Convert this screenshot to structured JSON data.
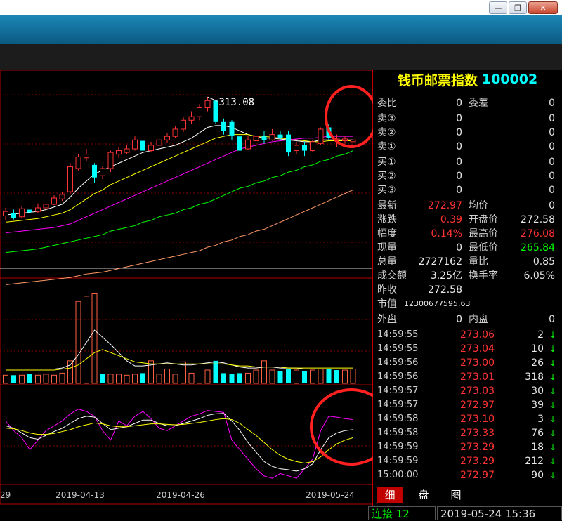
{
  "window": {
    "min_glyph": "—",
    "max_glyph": "❐",
    "close_glyph": "✕"
  },
  "chart_data": [
    {
      "type": "candlestick",
      "title": "",
      "annotations": [
        {
          "label": "313.08",
          "point": "high"
        }
      ],
      "series_colors": {
        "ma1": "#ffffff",
        "ma2": "#ffff00",
        "ma3": "#ff00ff",
        "ma4": "#00ff00",
        "ma5": "#ff9966"
      },
      "ylim": [
        220,
        330
      ],
      "candles": [
        {
          "o": 248.5,
          "c": 251.0,
          "h": 253.0,
          "l": 246.0
        },
        {
          "o": 250.0,
          "c": 247.5,
          "h": 252.0,
          "l": 246.5
        },
        {
          "o": 248.0,
          "c": 252.5,
          "h": 254.0,
          "l": 247.0
        },
        {
          "o": 252.0,
          "c": 250.5,
          "h": 254.5,
          "l": 249.0
        },
        {
          "o": 251.0,
          "c": 253.0,
          "h": 255.5,
          "l": 250.0
        },
        {
          "o": 253.0,
          "c": 255.0,
          "h": 257.0,
          "l": 252.0
        },
        {
          "o": 255.0,
          "c": 258.5,
          "h": 260.0,
          "l": 254.5
        },
        {
          "o": 258.0,
          "c": 260.5,
          "h": 262.0,
          "l": 257.0
        },
        {
          "o": 262.0,
          "c": 276.0,
          "h": 278.0,
          "l": 261.0
        },
        {
          "o": 275.0,
          "c": 281.5,
          "h": 283.0,
          "l": 274.0
        },
        {
          "o": 281.0,
          "c": 283.0,
          "h": 286.0,
          "l": 279.0
        },
        {
          "o": 277.0,
          "c": 270.0,
          "h": 278.0,
          "l": 267.0
        },
        {
          "o": 271.0,
          "c": 275.0,
          "h": 276.5,
          "l": 269.0
        },
        {
          "o": 275.0,
          "c": 284.0,
          "h": 285.0,
          "l": 273.0
        },
        {
          "o": 283.0,
          "c": 285.0,
          "h": 287.0,
          "l": 281.0
        },
        {
          "o": 284.0,
          "c": 286.0,
          "h": 288.0,
          "l": 283.0
        },
        {
          "o": 286.0,
          "c": 291.0,
          "h": 293.0,
          "l": 285.0
        },
        {
          "o": 290.5,
          "c": 285.0,
          "h": 292.0,
          "l": 283.0
        },
        {
          "o": 285.0,
          "c": 288.0,
          "h": 290.0,
          "l": 284.0
        },
        {
          "o": 288.0,
          "c": 291.0,
          "h": 292.5,
          "l": 286.0
        },
        {
          "o": 291.0,
          "c": 293.0,
          "h": 295.0,
          "l": 289.5
        },
        {
          "o": 293.0,
          "c": 297.0,
          "h": 298.5,
          "l": 292.0
        },
        {
          "o": 297.0,
          "c": 302.0,
          "h": 304.0,
          "l": 295.5
        },
        {
          "o": 302.0,
          "c": 304.0,
          "h": 307.0,
          "l": 300.0
        },
        {
          "o": 304.0,
          "c": 309.0,
          "h": 311.0,
          "l": 302.0
        },
        {
          "o": 309.0,
          "c": 313.0,
          "h": 315.0,
          "l": 307.0
        },
        {
          "o": 313.0,
          "c": 301.0,
          "h": 313.08,
          "l": 300.0
        },
        {
          "o": 301.0,
          "c": 296.0,
          "h": 303.0,
          "l": 294.0
        },
        {
          "o": 301.0,
          "c": 293.5,
          "h": 302.0,
          "l": 291.0
        },
        {
          "o": 293.0,
          "c": 285.0,
          "h": 296.0,
          "l": 284.0
        },
        {
          "o": 286.0,
          "c": 291.0,
          "h": 293.0,
          "l": 285.5
        },
        {
          "o": 290.5,
          "c": 293.0,
          "h": 295.0,
          "l": 289.0
        },
        {
          "o": 293.0,
          "c": 291.0,
          "h": 296.0,
          "l": 289.0
        },
        {
          "o": 291.0,
          "c": 294.0,
          "h": 297.0,
          "l": 290.5
        },
        {
          "o": 294.0,
          "c": 292.0,
          "h": 296.0,
          "l": 290.5
        },
        {
          "o": 294.0,
          "c": 284.0,
          "h": 296.0,
          "l": 282.0
        },
        {
          "o": 285.0,
          "c": 288.0,
          "h": 290.0,
          "l": 283.0
        },
        {
          "o": 288.0,
          "c": 285.0,
          "h": 290.0,
          "l": 282.0
        },
        {
          "o": 285.0,
          "c": 290.0,
          "h": 291.0,
          "l": 284.0
        },
        {
          "o": 289.0,
          "c": 297.0,
          "h": 298.0,
          "l": 288.0
        },
        {
          "o": 298.0,
          "c": 292.0,
          "h": 300.0,
          "l": 291.0
        },
        {
          "o": 291.0,
          "c": 291.5,
          "h": 294.0,
          "l": 287.0
        },
        {
          "o": 290.5,
          "c": 291.5,
          "h": 293.0,
          "l": 289.0
        },
        {
          "o": 290.0,
          "c": 291.0,
          "h": 292.0,
          "l": 288.5
        }
      ],
      "ma": {
        "ma1": [
          249,
          249.5,
          250,
          250.5,
          251,
          252,
          253.5,
          255,
          259,
          264,
          268,
          272,
          274,
          276,
          278,
          280,
          282,
          284,
          285,
          286,
          287,
          288,
          290,
          292,
          295,
          298,
          299,
          299,
          298,
          296,
          294,
          293,
          292,
          292,
          291.5,
          291,
          290.5,
          290,
          290,
          291,
          291,
          291,
          291,
          291
        ],
        "ma2": [
          245,
          245.5,
          246,
          246.5,
          247,
          248,
          249,
          250,
          252,
          255,
          258,
          261,
          263,
          266,
          268,
          270,
          272,
          274,
          276,
          278,
          280,
          282,
          284,
          286,
          288,
          290,
          292,
          293,
          294,
          294,
          294,
          293,
          293,
          292.5,
          292,
          291.5,
          291,
          290.5,
          290,
          290,
          290.5,
          290.5,
          290.5,
          290.5
        ],
        "ma3": [
          239,
          239.5,
          240,
          240.5,
          241,
          241.5,
          242,
          243,
          244,
          246,
          248,
          250,
          252,
          254,
          256,
          258,
          260,
          262,
          264,
          266,
          268,
          270,
          272,
          274,
          276,
          278,
          280,
          282,
          284,
          286,
          287,
          288,
          289,
          290,
          290.5,
          291,
          291.5,
          292,
          292,
          292.5,
          293,
          293,
          293,
          293
        ],
        "ma4": [
          228,
          228.5,
          229,
          229.5,
          230,
          231,
          232,
          233,
          234,
          235,
          236,
          237,
          238,
          240,
          241,
          242,
          243,
          245,
          246,
          248,
          249,
          250,
          252,
          253,
          255,
          256,
          258,
          260,
          262,
          264,
          265,
          267,
          268,
          270,
          271,
          273,
          274,
          276,
          277,
          279,
          280,
          282,
          283,
          285
        ],
        "ma5": [
          210,
          210.5,
          211,
          211.5,
          212,
          212.5,
          213,
          213.5,
          214,
          215,
          216,
          216.5,
          217,
          218,
          219,
          220,
          221,
          222,
          223,
          224,
          225,
          226,
          227,
          228,
          229,
          231,
          232,
          234,
          235,
          237,
          238,
          240,
          241,
          243,
          245,
          247,
          249,
          251,
          253,
          255,
          257,
          259,
          261,
          263
        ]
      }
    },
    {
      "type": "bar",
      "title": "",
      "ylim": [
        0,
        100
      ],
      "values": [
        8,
        8,
        8,
        9,
        8,
        9,
        8,
        10,
        22,
        80,
        85,
        88,
        9,
        9,
        9,
        8,
        9,
        10,
        22,
        9,
        14,
        9,
        21,
        10,
        12,
        13,
        22,
        10,
        9,
        10,
        10,
        13,
        22,
        13,
        12,
        14,
        13,
        12,
        13,
        14,
        14,
        13,
        13,
        14
      ],
      "up": [
        1,
        0,
        1,
        0,
        1,
        1,
        1,
        1,
        1,
        1,
        1,
        1,
        0,
        1,
        1,
        1,
        1,
        0,
        1,
        1,
        1,
        1,
        1,
        1,
        1,
        1,
        0,
        0,
        0,
        0,
        1,
        1,
        1,
        1,
        0,
        0,
        1,
        0,
        1,
        1,
        0,
        0,
        1,
        1
      ],
      "ma1": [
        14,
        14,
        14,
        14,
        14,
        14,
        14,
        15,
        18,
        28,
        40,
        52,
        45,
        38,
        30,
        22,
        17,
        17,
        18,
        19,
        20,
        19,
        18,
        18,
        19,
        20,
        21,
        20,
        18,
        16,
        15,
        15,
        16,
        16,
        15,
        15,
        15,
        14,
        14,
        14,
        14,
        14,
        14,
        14
      ],
      "ma2": [
        13,
        13,
        13,
        13,
        13,
        13,
        13,
        14,
        15,
        18,
        24,
        30,
        33,
        30,
        27,
        24,
        21,
        20,
        19,
        19,
        19,
        19,
        19,
        19,
        19,
        19,
        19,
        19,
        18,
        17,
        17,
        16,
        16,
        16,
        16,
        15,
        15,
        15,
        15,
        15,
        15,
        15,
        15,
        15
      ]
    },
    {
      "type": "line",
      "title": "",
      "ylim": [
        -100,
        100
      ],
      "x_ticks": [
        "29",
        "2019-04-13",
        "2019-04-26",
        "2019-05-24"
      ],
      "series": [
        {
          "color": "#ff00ff",
          "values": [
            30,
            10,
            -5,
            -30,
            -10,
            10,
            20,
            30,
            45,
            55,
            50,
            40,
            10,
            -10,
            30,
            20,
            40,
            50,
            35,
            15,
            10,
            20,
            30,
            40,
            45,
            52,
            50,
            48,
            -10,
            -30,
            -50,
            -70,
            -85,
            -90,
            -80,
            -85,
            -90,
            -70,
            -50,
            10,
            40,
            38,
            35,
            33
          ]
        },
        {
          "color": "#ffffff",
          "values": [
            20,
            15,
            5,
            -5,
            -8,
            0,
            8,
            15,
            25,
            35,
            40,
            38,
            25,
            12,
            15,
            18,
            25,
            32,
            32,
            25,
            20,
            20,
            25,
            30,
            35,
            42,
            45,
            46,
            30,
            10,
            -15,
            -35,
            -55,
            -65,
            -70,
            -72,
            -75,
            -70,
            -60,
            -30,
            -5,
            5,
            10,
            12
          ]
        },
        {
          "color": "#ffff00",
          "values": [
            15,
            14,
            10,
            5,
            2,
            2,
            4,
            8,
            12,
            18,
            22,
            26,
            24,
            20,
            18,
            18,
            20,
            22,
            24,
            24,
            23,
            22,
            23,
            25,
            27,
            30,
            33,
            35,
            33,
            25,
            12,
            0,
            -15,
            -30,
            -42,
            -50,
            -55,
            -58,
            -55,
            -45,
            -30,
            -18,
            -10,
            -5
          ]
        }
      ]
    }
  ],
  "quote": {
    "name": "钱币邮票指数",
    "code": "100002",
    "weibi_label": "委比",
    "weibi_value": "0",
    "weicha_label": "委差",
    "weicha_value": "0",
    "sell": [
      {
        "label": "卖③",
        "price": "0",
        "vol": "0"
      },
      {
        "label": "卖②",
        "price": "0",
        "vol": "0"
      },
      {
        "label": "卖①",
        "price": "0",
        "vol": "0"
      }
    ],
    "buy": [
      {
        "label": "买①",
        "price": "0",
        "vol": "0"
      },
      {
        "label": "买②",
        "price": "0",
        "vol": "0"
      },
      {
        "label": "买③",
        "price": "0",
        "vol": "0"
      }
    ],
    "stats": {
      "zuixin_label": "最新",
      "zuixin": "272.97",
      "junjia_label": "均价",
      "junjia": "0",
      "zhangdie_label": "涨跌",
      "zhangdie": "0.39",
      "kaipan_label": "开盘价",
      "kaipan": "272.58",
      "fudu_label": "幅度",
      "fudu": "0.14%",
      "zuigao_label": "最高价",
      "zuigao": "276.08",
      "xianliang_label": "现量",
      "xianliang": "0",
      "zuidi_label": "最低价",
      "zuidi": "265.84",
      "zongliang_label": "总量",
      "zongliang": "2727162",
      "liangbi_label": "量比",
      "liangbi": "0.85",
      "chengjiao_label": "成交额",
      "chengjiao": "3.25亿",
      "huanshou_label": "换手率",
      "huanshou": "6.05%",
      "zuoshou_label": "昨收",
      "zuoshou": "272.58",
      "shizhi_label": "市值",
      "shizhi": "12300677595.63",
      "waipan_label": "外盘",
      "waipan": "0",
      "neipan_label": "内盘",
      "neipan": "0"
    },
    "ticks": [
      {
        "time": "14:59:55",
        "price": "273.06",
        "vol": "2",
        "arrow": "↓"
      },
      {
        "time": "14:59:55",
        "price": "273.04",
        "vol": "10",
        "arrow": "↓"
      },
      {
        "time": "14:59:56",
        "price": "273.00",
        "vol": "26",
        "arrow": "↓"
      },
      {
        "time": "14:59:56",
        "price": "273.01",
        "vol": "318",
        "arrow": "↓"
      },
      {
        "time": "14:59:57",
        "price": "273.03",
        "vol": "30",
        "arrow": "↓"
      },
      {
        "time": "14:59:57",
        "price": "272.97",
        "vol": "39",
        "arrow": "↓"
      },
      {
        "time": "14:59:58",
        "price": "273.10",
        "vol": "3",
        "arrow": "↓"
      },
      {
        "time": "14:59:58",
        "price": "273.33",
        "vol": "76",
        "arrow": "↓"
      },
      {
        "time": "14:59:59",
        "price": "273.29",
        "vol": "18",
        "arrow": "↓"
      },
      {
        "time": "14:59:59",
        "price": "273.29",
        "vol": "212",
        "arrow": "↓"
      },
      {
        "time": "15:00:00",
        "price": "272.97",
        "vol": "90",
        "arrow": "↓"
      }
    ],
    "tabs": [
      "细",
      "盘",
      "图"
    ]
  },
  "status": {
    "connection": "连接 12",
    "datetime": "2019-05-24 15:36"
  }
}
